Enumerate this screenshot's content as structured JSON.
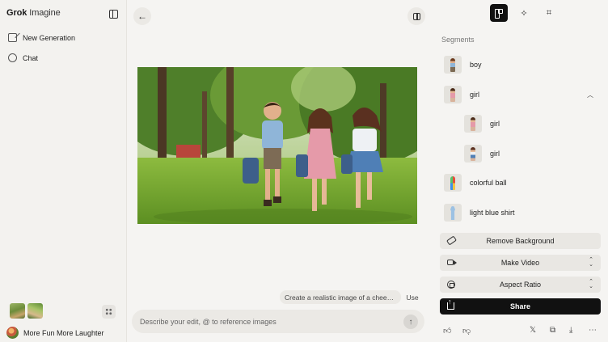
{
  "sidebar": {
    "brand_bold": "Grok",
    "brand_light": " Imagine",
    "nav": [
      {
        "label": "New Generation",
        "icon": "edit-icon"
      },
      {
        "label": "Chat",
        "icon": "chat-icon"
      }
    ],
    "user_name": "More Fun More Laughter"
  },
  "main": {
    "suggestion": "Create a realistic image of a chee…",
    "use_label": "Use",
    "prompt_placeholder": "Describe your edit, @ to reference images"
  },
  "panel": {
    "segments_title": "Segments",
    "segments": [
      {
        "label": "boy"
      },
      {
        "label": "girl",
        "expanded": true,
        "children": [
          "girl",
          "girl"
        ]
      },
      {
        "label": "colorful ball"
      },
      {
        "label": "light blue shirt"
      }
    ],
    "actions": {
      "remove_bg": "Remove Background",
      "make_video": "Make Video",
      "aspect_ratio": "Aspect Ratio",
      "share": "Share"
    }
  },
  "colors": {
    "background": "#f5f4f2",
    "accent": "#111111",
    "button": "#e9e7e3"
  }
}
